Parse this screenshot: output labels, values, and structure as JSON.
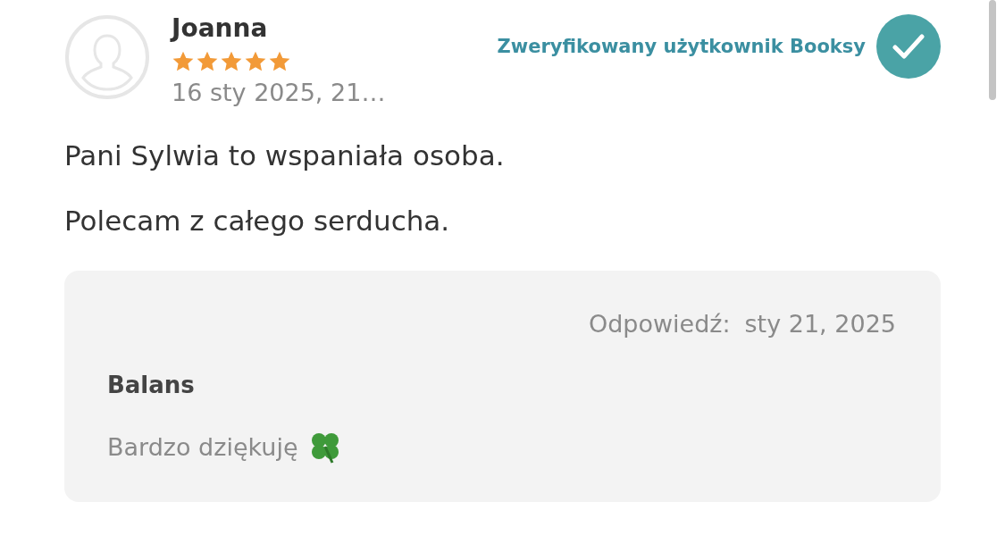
{
  "review": {
    "author": "Joanna",
    "stars": 5,
    "date": "16 sty 2025, 21…",
    "verified": true,
    "verified_label": "Zweryfikowany użytkownik Booksy",
    "paragraphs": [
      "Pani Sylwia to wspaniała osoba.",
      "Polecam z całego serducha."
    ]
  },
  "reply": {
    "label": "Odpowiedź:",
    "date": "sty 21, 2025",
    "author": "Balans",
    "text": "Bardzo dziękuję"
  }
}
